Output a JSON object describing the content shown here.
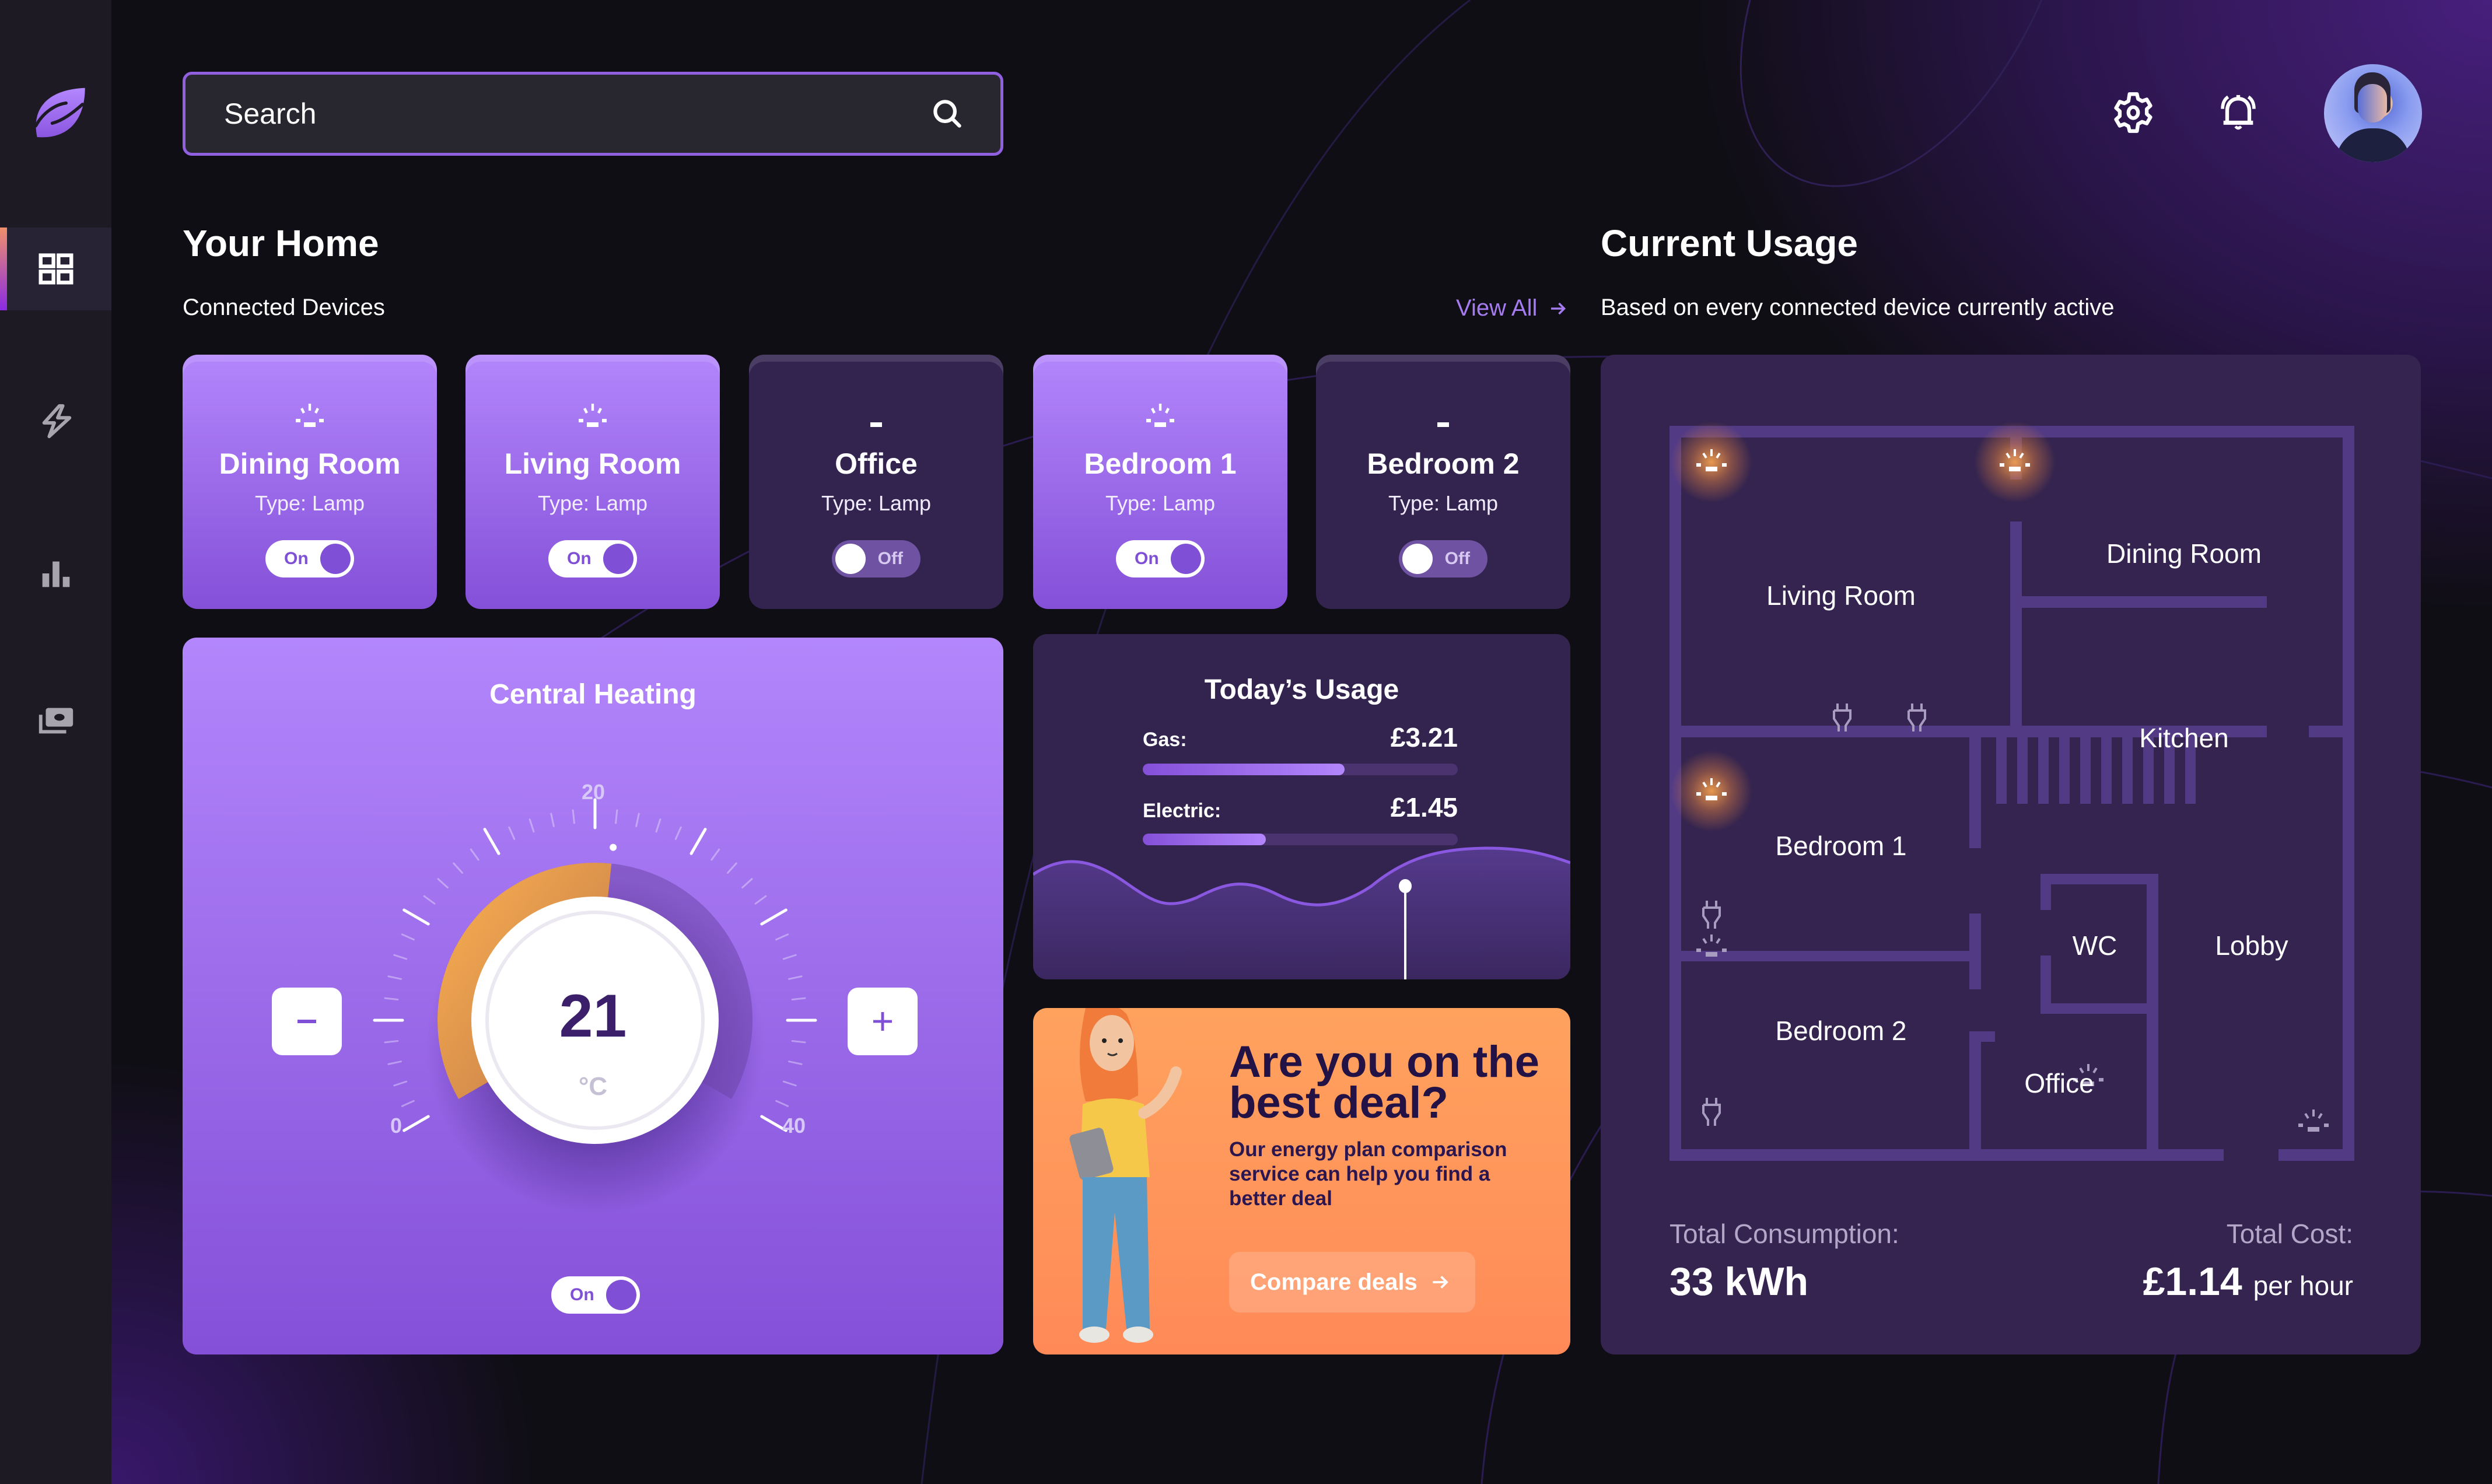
{
  "colors": {
    "accent": "#8450d8",
    "accent_light": "#b386fc",
    "card_dark": "#33244f",
    "promo_orange": "#ff8a58",
    "lamp_glow": "#f0a050",
    "text_dark": "#221245"
  },
  "sidebar": {
    "logo": "leaf-logo-icon",
    "items": [
      {
        "id": "dashboard",
        "icon": "grid-icon",
        "active": true
      },
      {
        "id": "energy",
        "icon": "lightning-icon",
        "active": false
      },
      {
        "id": "stats",
        "icon": "bar-chart-icon",
        "active": false
      },
      {
        "id": "billing",
        "icon": "money-icon",
        "active": false
      }
    ]
  },
  "header": {
    "search_placeholder": "Search",
    "icons": [
      "gear-icon",
      "bell-icon"
    ],
    "avatar": "user-avatar"
  },
  "home": {
    "title": "Your Home",
    "subtitle": "Connected Devices",
    "view_all": "View All",
    "devices": [
      {
        "name": "Dining Room",
        "type": "Type: Lamp",
        "state": "On",
        "on": true
      },
      {
        "name": "Living Room",
        "type": "Type: Lamp",
        "state": "On",
        "on": true
      },
      {
        "name": "Office",
        "type": "Type: Lamp",
        "state": "Off",
        "on": false
      },
      {
        "name": "Bedroom 1",
        "type": "Type: Lamp",
        "state": "On",
        "on": true
      },
      {
        "name": "Bedroom 2",
        "type": "Type: Lamp",
        "state": "Off",
        "on": false
      }
    ]
  },
  "heating": {
    "title": "Central Heating",
    "temperature": "21",
    "unit": "°C",
    "scale_min": "0",
    "scale_mid": "20",
    "scale_max": "40",
    "value": 21,
    "min": 0,
    "max": 40,
    "state": "On"
  },
  "usage": {
    "title": "Today’s Usage",
    "rows": [
      {
        "label": "Gas:",
        "value": "£3.21",
        "fraction": 0.64
      },
      {
        "label": "Electric:",
        "value": "£1.45",
        "fraction": 0.39
      }
    ]
  },
  "promo": {
    "headline": "Are you on the best deal?",
    "body": "Our energy plan comparison service can help you find a better deal",
    "cta": "Compare deals"
  },
  "current": {
    "title": "Current Usage",
    "subtitle": "Based on every connected device currently active",
    "rooms": [
      "Living Room",
      "Dining Room",
      "Kitchen",
      "Bedroom 1",
      "Bedroom 2",
      "WC",
      "Lobby",
      "Office"
    ],
    "consumption_label": "Total Consumption:",
    "consumption_value": "33 kWh",
    "cost_label": "Total Cost:",
    "cost_value": "£1.14",
    "cost_unit": "per hour"
  }
}
